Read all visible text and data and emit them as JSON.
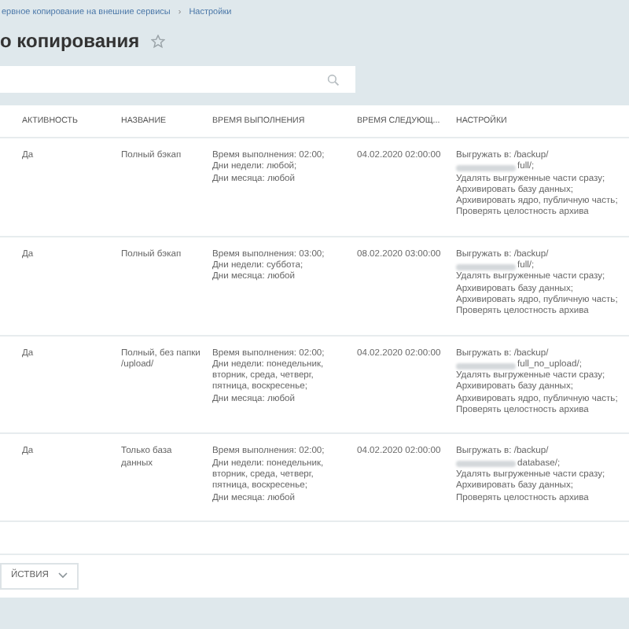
{
  "breadcrumbs": [
    {
      "label": "ервное копирование на внешние сервисы"
    },
    {
      "label": "Настройки"
    }
  ],
  "separator": "›",
  "title": "о копирования",
  "table": {
    "columns": [
      "АКТИВНОСТЬ",
      "НАЗВАНИЕ",
      "ВРЕМЯ ВЫПОЛНЕНИЯ",
      "ВРЕМЯ СЛЕДУЮЩ...",
      "НАСТРОЙКИ"
    ],
    "rows": [
      {
        "active": "Да",
        "name": "Полный бэкап",
        "schedule": [
          "Время выполнения: 02:00;",
          "Дни недели: любой;",
          "Дни месяца: любой"
        ],
        "next": "04.02.2020 02:00:00",
        "path_prefix": "Выгружать в: /backup/",
        "path_suffix": "full/;",
        "settings": [
          "Удалять выгруженные части сразу;",
          "Архивировать базу данных;",
          "Архивировать ядро, публичную часть;",
          "Проверять целостность архива"
        ]
      },
      {
        "active": "Да",
        "name": "Полный бэкап",
        "schedule": [
          "Время выполнения: 03:00;",
          "Дни недели: суббота;",
          "Дни месяца: любой"
        ],
        "next": "08.02.2020 03:00:00",
        "path_prefix": "Выгружать в: /backup/",
        "path_suffix": "full/;",
        "settings": [
          "Удалять выгруженные части сразу;",
          "Архивировать базу данных;",
          "Архивировать ядро, публичную часть;",
          "Проверять целостность архива"
        ]
      },
      {
        "active": "Да",
        "name": "Полный, без папки /upload/",
        "schedule": [
          "Время выполнения: 02:00;",
          "Дни недели: понедельник, вторник, среда, четверг, пятница, воскресенье;",
          "Дни месяца: любой"
        ],
        "next": "04.02.2020 02:00:00",
        "path_prefix": "Выгружать в: /backup/",
        "path_suffix": "full_no_upload/;",
        "settings": [
          "Удалять выгруженные части сразу;",
          "Архивировать базу данных;",
          "Архивировать ядро, публичную часть;",
          "Проверять целостность архива"
        ]
      },
      {
        "active": "Да",
        "name": "Только база данных",
        "schedule": [
          "Время выполнения: 02:00;",
          "Дни недели: понедельник, вторник, среда, четверг, пятница, воскресенье;",
          "Дни месяца: любой"
        ],
        "next": "04.02.2020 02:00:00",
        "path_prefix": "Выгружать в: /backup/",
        "path_suffix": "database/;",
        "settings": [
          "Удалять выгруженные части сразу;",
          "Архивировать базу данных;",
          "Проверять целостность архива"
        ]
      }
    ]
  },
  "actions_button": "ЙСТВИЯ"
}
